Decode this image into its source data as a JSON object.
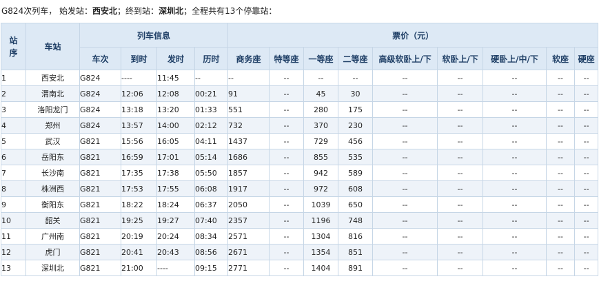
{
  "summary": {
    "part1": "G824次列车， 始发站：",
    "origin": "西安北",
    "part2": "；终到站：",
    "terminus": "深圳北",
    "part3": "；全程共有13个停靠站："
  },
  "header": {
    "seq": "站序",
    "station": "车站",
    "train_info": "列车信息",
    "fare": "票价（元）",
    "train_no": "车次",
    "arrive": "到时",
    "depart": "发时",
    "elapsed": "历时",
    "seats": [
      "商务座",
      "特等座",
      "一等座",
      "二等座",
      "高级软卧上/下",
      "软卧上/下",
      "硬卧上/中/下",
      "软座",
      "硬座"
    ]
  },
  "rows": [
    {
      "seq": "1",
      "station": "西安北",
      "train": "G824",
      "arrive": "----",
      "depart": "11:45",
      "elapsed": "--",
      "fares": [
        "--",
        "--",
        "--",
        "--",
        "--",
        "--",
        "--",
        "--",
        "--"
      ]
    },
    {
      "seq": "2",
      "station": "渭南北",
      "train": "G824",
      "arrive": "12:06",
      "depart": "12:08",
      "elapsed": "00:21",
      "fares": [
        "91",
        "--",
        "45",
        "30",
        "--",
        "--",
        "--",
        "--",
        "--"
      ]
    },
    {
      "seq": "3",
      "station": "洛阳龙门",
      "train": "G824",
      "arrive": "13:18",
      "depart": "13:20",
      "elapsed": "01:33",
      "fares": [
        "551",
        "--",
        "280",
        "175",
        "--",
        "--",
        "--",
        "--",
        "--"
      ]
    },
    {
      "seq": "4",
      "station": "郑州",
      "train": "G824",
      "arrive": "13:57",
      "depart": "14:00",
      "elapsed": "02:12",
      "fares": [
        "732",
        "--",
        "370",
        "230",
        "--",
        "--",
        "--",
        "--",
        "--"
      ]
    },
    {
      "seq": "5",
      "station": "武汉",
      "train": "G821",
      "arrive": "15:56",
      "depart": "16:05",
      "elapsed": "04:11",
      "fares": [
        "1437",
        "--",
        "729",
        "456",
        "--",
        "--",
        "--",
        "--",
        "--"
      ]
    },
    {
      "seq": "6",
      "station": "岳阳东",
      "train": "G821",
      "arrive": "16:59",
      "depart": "17:01",
      "elapsed": "05:14",
      "fares": [
        "1686",
        "--",
        "855",
        "535",
        "--",
        "--",
        "--",
        "--",
        "--"
      ]
    },
    {
      "seq": "7",
      "station": "长沙南",
      "train": "G821",
      "arrive": "17:35",
      "depart": "17:38",
      "elapsed": "05:50",
      "fares": [
        "1857",
        "--",
        "942",
        "589",
        "--",
        "--",
        "--",
        "--",
        "--"
      ]
    },
    {
      "seq": "8",
      "station": "株洲西",
      "train": "G821",
      "arrive": "17:53",
      "depart": "17:55",
      "elapsed": "06:08",
      "fares": [
        "1917",
        "--",
        "972",
        "608",
        "--",
        "--",
        "--",
        "--",
        "--"
      ]
    },
    {
      "seq": "9",
      "station": "衡阳东",
      "train": "G821",
      "arrive": "18:22",
      "depart": "18:24",
      "elapsed": "06:37",
      "fares": [
        "2050",
        "--",
        "1039",
        "650",
        "--",
        "--",
        "--",
        "--",
        "--"
      ]
    },
    {
      "seq": "10",
      "station": "韶关",
      "train": "G821",
      "arrive": "19:25",
      "depart": "19:27",
      "elapsed": "07:40",
      "fares": [
        "2357",
        "--",
        "1196",
        "748",
        "--",
        "--",
        "--",
        "--",
        "--"
      ]
    },
    {
      "seq": "11",
      "station": "广州南",
      "train": "G821",
      "arrive": "20:19",
      "depart": "20:24",
      "elapsed": "08:34",
      "fares": [
        "2571",
        "--",
        "1304",
        "816",
        "--",
        "--",
        "--",
        "--",
        "--"
      ]
    },
    {
      "seq": "12",
      "station": "虎门",
      "train": "G821",
      "arrive": "20:41",
      "depart": "20:43",
      "elapsed": "08:56",
      "fares": [
        "2671",
        "--",
        "1354",
        "851",
        "--",
        "--",
        "--",
        "--",
        "--"
      ]
    },
    {
      "seq": "13",
      "station": "深圳北",
      "train": "G821",
      "arrive": "21:00",
      "depart": "----",
      "elapsed": "09:15",
      "fares": [
        "2771",
        "--",
        "1404",
        "891",
        "--",
        "--",
        "--",
        "--",
        "--"
      ]
    }
  ]
}
